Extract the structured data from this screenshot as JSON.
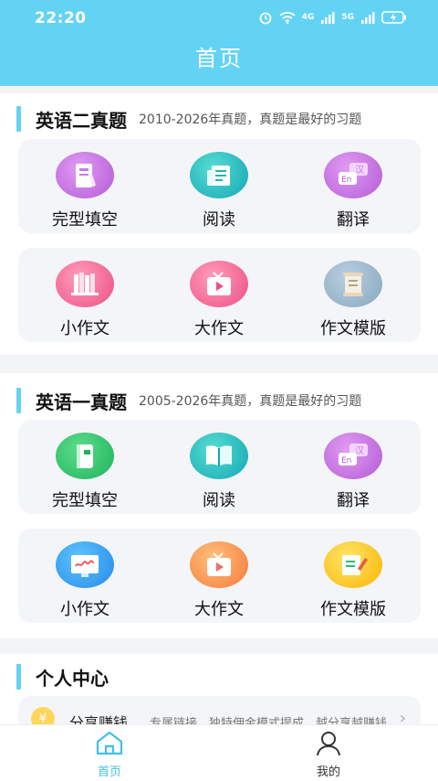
{
  "status_bar": {
    "time": "22:20",
    "network_1": "4G",
    "network_2": "5G"
  },
  "header": {
    "title": "首页"
  },
  "sections": [
    {
      "title": "英语二真题",
      "subtitle": "2010-2026年真题，真题是最好的习题",
      "items": [
        {
          "label": "完型填空",
          "icon": "cloze-icon",
          "color": "purple"
        },
        {
          "label": "阅读",
          "icon": "reading-icon",
          "color": "teal"
        },
        {
          "label": "翻译",
          "icon": "translate-icon",
          "color": "purple"
        },
        {
          "label": "小作文",
          "icon": "books-icon",
          "color": "pink"
        },
        {
          "label": "大作文",
          "icon": "tv-icon",
          "color": "pink"
        },
        {
          "label": "作文模版",
          "icon": "scroll-icon",
          "color": "gray"
        }
      ]
    },
    {
      "title": "英语一真题",
      "subtitle": "2005-2026年真题，真题是最好的习题",
      "items": [
        {
          "label": "完型填空",
          "icon": "book-icon",
          "color": "green"
        },
        {
          "label": "阅读",
          "icon": "open-book-icon",
          "color": "teal"
        },
        {
          "label": "翻译",
          "icon": "translate-icon",
          "color": "purple"
        },
        {
          "label": "小作文",
          "icon": "whiteboard-icon",
          "color": "blue"
        },
        {
          "label": "大作文",
          "icon": "tv-icon",
          "color": "orange"
        },
        {
          "label": "作文模版",
          "icon": "edit-icon",
          "color": "yellow"
        }
      ]
    }
  ],
  "personal": {
    "title": "个人中心",
    "share_title": "分享赚钱",
    "share_desc": "专属链接，独特佣金模式提成，越分享越赚钱",
    "arrow": "›"
  },
  "tabs": [
    {
      "label": "首页",
      "icon": "home-icon",
      "active": true
    },
    {
      "label": "我的",
      "icon": "user-icon",
      "active": false
    }
  ],
  "colors": {
    "accent": "#63d3f4",
    "tab_active": "#3fc2ea",
    "tab_inactive": "#333333"
  }
}
